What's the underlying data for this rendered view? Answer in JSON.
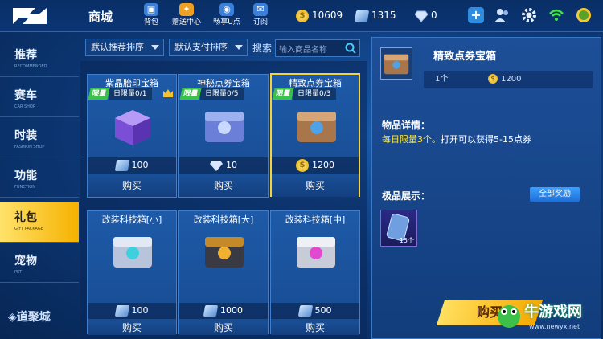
{
  "header": {
    "title": "商城",
    "top_icons": [
      {
        "label": "背包",
        "icon": "backpack-icon"
      },
      {
        "label": "赠送中心",
        "icon": "gift-center-icon"
      },
      {
        "label": "畅享U点",
        "icon": "u-points-icon"
      },
      {
        "label": "订阅",
        "icon": "subscribe-icon"
      }
    ],
    "coins": "10609",
    "tickets": "1315",
    "diamonds": "0"
  },
  "sidebar": {
    "items": [
      {
        "label": "推荐",
        "sub": "RECOMMENDED"
      },
      {
        "label": "赛车",
        "sub": "CAR SHOP"
      },
      {
        "label": "时装",
        "sub": "FASHION SHOP"
      },
      {
        "label": "功能",
        "sub": "FUNCTION"
      },
      {
        "label": "礼包",
        "sub": "GIFT PACKAGE"
      },
      {
        "label": "宠物",
        "sub": "PET"
      }
    ],
    "active_index": 4,
    "brand": "道聚城"
  },
  "filters": {
    "sort_recommend": "默认推荐排序",
    "sort_payment": "默认支付排序",
    "search_label": "搜索",
    "search_placeholder": "输入商品名称"
  },
  "items": [
    {
      "name": "紫晶胎印宝箱",
      "limit_tag": "限量",
      "limit": "日限量0/1",
      "price": "100",
      "currency": "ticket",
      "buy": "购买"
    },
    {
      "name": "神秘点券宝箱",
      "limit_tag": "限量",
      "limit": "日限量0/5",
      "price": "10",
      "currency": "diamond",
      "buy": "购买"
    },
    {
      "name": "精致点券宝箱",
      "limit_tag": "限量",
      "limit": "日限量0/3",
      "price": "1200",
      "currency": "coin",
      "buy": "购买"
    },
    {
      "name": "改装科技箱[小]",
      "price": "100",
      "currency": "ticket",
      "buy": "购买"
    },
    {
      "name": "改装科技箱[大]",
      "price": "1000",
      "currency": "ticket",
      "buy": "购买"
    },
    {
      "name": "改装科技箱[中]",
      "price": "500",
      "currency": "ticket",
      "buy": "购买"
    }
  ],
  "detail": {
    "name": "精致点券宝箱",
    "qty": "1个",
    "price": "1200",
    "info_title": "物品详情：",
    "desc_highlight": "每日限量3个。",
    "desc_rest": "打开可以获得5-15点券",
    "showcase_title": "极品展示：",
    "all_rewards": "全部奖励",
    "prize_count": "15个",
    "buy": "购买"
  },
  "watermark": {
    "name": "牛游戏网",
    "url": "www.newyx.net"
  },
  "colors": {
    "accent": "#f6b100",
    "highlight": "#f7e34a",
    "panel": "#1d4f98",
    "limit_green": "#39c24a"
  }
}
